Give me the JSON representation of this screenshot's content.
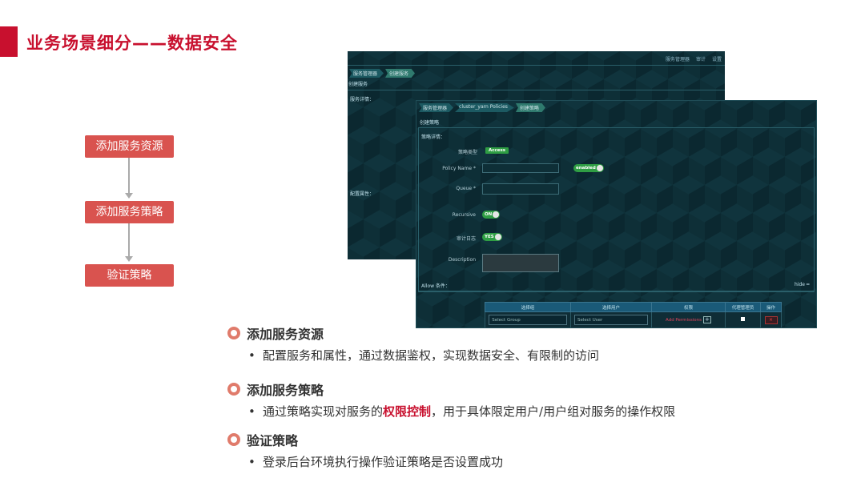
{
  "title": "业务场景细分——数据安全",
  "flow": [
    "添加服务资源",
    "添加服务策略",
    "验证策略"
  ],
  "back_screen": {
    "topnav": [
      "服务管理器",
      "审计",
      "设置"
    ],
    "crumbs": [
      "服务管理器",
      "创建服务"
    ],
    "page_title": "创建服务",
    "service_detail": "服务详情：",
    "config_props": "配置属性："
  },
  "front_screen": {
    "crumbs": [
      "服务管理器",
      "cluster_yarn Policies",
      "创建策略"
    ],
    "page_title": "创建策略",
    "section_detail": "策略详情：",
    "policy_type_label": "策略类型",
    "policy_type_value": "Access",
    "policy_name_label": "Policy Name *",
    "enabled_toggle": "enabled",
    "queue_label": "Queue *",
    "recursive_label": "Recursive",
    "recursive_toggle": "ON",
    "audit_label": "审计日志",
    "audit_toggle": "YES",
    "description_label": "Description",
    "allow_section": "Allow 条件：",
    "hide_link": "hide",
    "table_headers": [
      "选择组",
      "选择用户",
      "权限",
      "代理管理员",
      "操作"
    ],
    "row": {
      "group_placeholder": "Select Group",
      "user_placeholder": "Select User",
      "add_permissions": "Add Permissions",
      "plus": "+",
      "delete": "×"
    }
  },
  "bullets": [
    {
      "title": "添加服务资源",
      "desc_before": "配置服务和属性，通过数据鉴权，实现数据安全、有限制的访问",
      "highlight": "",
      "desc_after": ""
    },
    {
      "title": "添加服务策略",
      "desc_before": "通过策略实现对服务的",
      "highlight": "权限控制",
      "desc_after": "，用于具体限定用户/用户组对服务的操作权限"
    },
    {
      "title": "验证策略",
      "desc_before": "登录后台环境执行操作验证策略是否设置成功",
      "highlight": "",
      "desc_after": ""
    }
  ],
  "colors": {
    "accent": "#c8102e",
    "flow_box": "#d9534f",
    "ring": "#e07b6b",
    "screen_bg": "#0b2830",
    "toggle_on": "#2f9e44"
  }
}
